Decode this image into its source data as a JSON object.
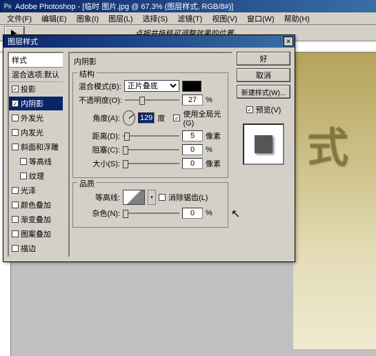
{
  "app": {
    "title": "Adobe Photoshop - [临时 图片.jpg @ 67.3% (图层样式, RGB/8#)]",
    "icon_letter": "Ps"
  },
  "menu": [
    "文件(F)",
    "编辑(E)",
    "图象(I)",
    "图层(L)",
    "选择(S)",
    "滤镜(T)",
    "视图(V)",
    "窗口(W)",
    "帮助(H)"
  ],
  "tool_hint": "点按并拖移可调整效果的位置。",
  "doc_text": "式",
  "dialog": {
    "title": "图层样式",
    "styles_header": "样式",
    "blend_default": "混合选项:默认",
    "items": [
      {
        "label": "投影",
        "checked": true,
        "selected": false,
        "indent": 0
      },
      {
        "label": "内阴影",
        "checked": true,
        "selected": true,
        "indent": 0
      },
      {
        "label": "外发光",
        "checked": false,
        "selected": false,
        "indent": 0
      },
      {
        "label": "内发光",
        "checked": false,
        "selected": false,
        "indent": 0
      },
      {
        "label": "斜面和浮雕",
        "checked": false,
        "selected": false,
        "indent": 0
      },
      {
        "label": "等高线",
        "checked": false,
        "selected": false,
        "indent": 1
      },
      {
        "label": "纹理",
        "checked": false,
        "selected": false,
        "indent": 1
      },
      {
        "label": "光泽",
        "checked": false,
        "selected": false,
        "indent": 0
      },
      {
        "label": "颜色叠加",
        "checked": false,
        "selected": false,
        "indent": 0
      },
      {
        "label": "渐变叠加",
        "checked": false,
        "selected": false,
        "indent": 0
      },
      {
        "label": "图案叠加",
        "checked": false,
        "selected": false,
        "indent": 0
      },
      {
        "label": "描边",
        "checked": false,
        "selected": false,
        "indent": 0
      }
    ],
    "panel_title": "内阴影",
    "structure": {
      "group": "结构",
      "blend_label": "混合模式(B):",
      "blend_value": "正片叠底",
      "opacity_label": "不透明度(O):",
      "opacity_value": "27",
      "opacity_unit": "%",
      "angle_label": "角度(A):",
      "angle_value": "129",
      "angle_unit": "度",
      "global_label": "使用全局光(G)",
      "distance_label": "距离(D):",
      "distance_value": "5",
      "distance_unit": "像素",
      "choke_label": "阻塞(C):",
      "choke_value": "0",
      "choke_unit": "%",
      "size_label": "大小(S):",
      "size_value": "0",
      "size_unit": "像素"
    },
    "quality": {
      "group": "品质",
      "contour_label": "等高线:",
      "antialias_label": "消除锯齿(L)",
      "noise_label": "杂色(N):",
      "noise_value": "0",
      "noise_unit": "%"
    },
    "buttons": {
      "ok": "好",
      "cancel": "取消",
      "newstyle": "新建样式(W)...",
      "preview": "预览(V)"
    }
  }
}
